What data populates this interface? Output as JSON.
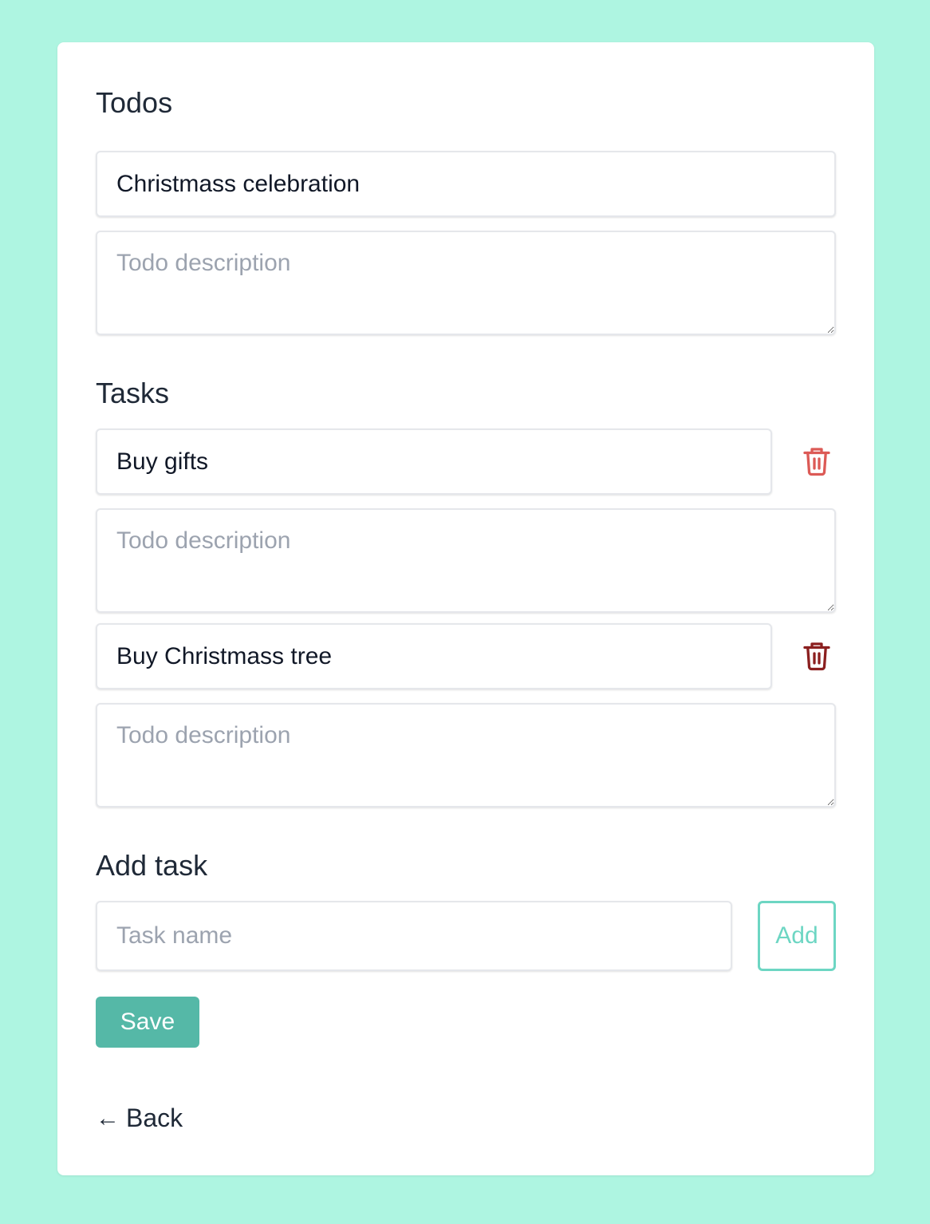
{
  "todo": {
    "heading": "Todos",
    "title_value": "Christmass celebration",
    "description_placeholder": "Todo description"
  },
  "tasks": {
    "heading": "Tasks",
    "items": [
      {
        "name": "Buy gifts",
        "description_placeholder": "Todo description",
        "delete_icon": "trash-icon",
        "delete_color": "#dc5a56"
      },
      {
        "name": "Buy Christmass tree",
        "description_placeholder": "Todo description",
        "delete_icon": "trash-icon",
        "delete_color": "#8b1f1f"
      }
    ]
  },
  "add_task": {
    "heading": "Add task",
    "placeholder": "Task name",
    "button_label": "Add"
  },
  "save_label": "Save",
  "back": {
    "arrow": "←",
    "label": "Back"
  },
  "colors": {
    "background": "#aef5e1",
    "accent": "#55b8a7",
    "add_border": "#6dd6c3"
  }
}
